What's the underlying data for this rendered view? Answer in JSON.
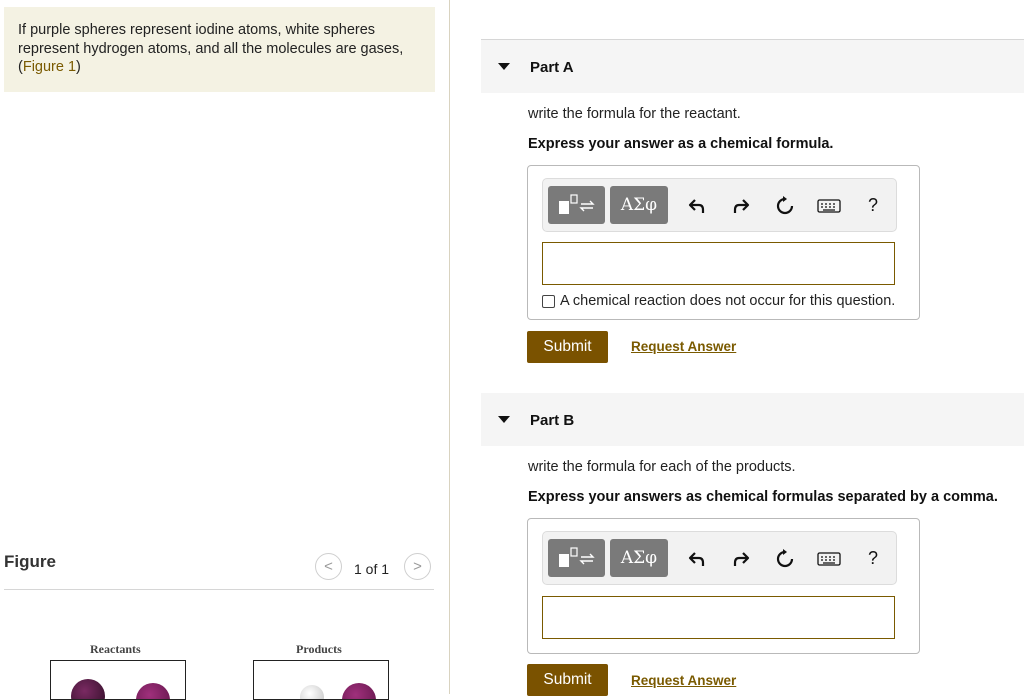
{
  "problem": {
    "text": "If purple spheres represent iodine atoms, white spheres represent hydrogen atoms, and all the molecules are gases,",
    "figure_open": "(",
    "figure_link": "Figure 1",
    "figure_close": ")"
  },
  "figure_panel": {
    "title": "Figure",
    "prev_icon": "chevron-left-icon",
    "next_icon": "chevron-right-icon",
    "prev_glyph": "<",
    "next_glyph": ">",
    "count": "1 of 1",
    "reactants_label": "Reactants",
    "products_label": "Products",
    "colors": {
      "iodine": "#7b1c5c",
      "dark_sphere": "#3a1230",
      "hydrogen": "#e6e6e6"
    }
  },
  "toolbar": {
    "templates_icon": "templates-icon",
    "symbols_label": "ΑΣφ",
    "undo_icon": "undo-icon",
    "redo_icon": "redo-icon",
    "reset_icon": "reset-icon",
    "keyboard_icon": "keyboard-icon",
    "help_label": "?"
  },
  "parts": [
    {
      "title": "Part A",
      "question": "write the formula for the reactant.",
      "instruction": "Express your answer as a chemical formula.",
      "answer_value": "",
      "no_reaction_label": "A chemical reaction does not occur for this question.",
      "submit_label": "Submit",
      "request_label": "Request Answer"
    },
    {
      "title": "Part B",
      "question": "write the formula for each of the products.",
      "instruction": "Express your answers as chemical formulas separated by a comma.",
      "answer_value": "",
      "submit_label": "Submit",
      "request_label": "Request Answer"
    }
  ],
  "colors": {
    "accent": "#7a5200",
    "link": "#7a5a00",
    "prompt_bg": "#f4f2e3",
    "part_header_bg": "#f5f5f5"
  }
}
